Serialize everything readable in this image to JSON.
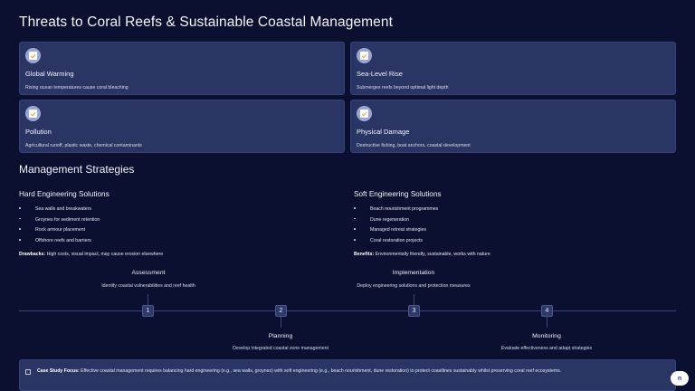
{
  "title": "Threats to Coral Reefs & Sustainable Coastal Management",
  "threats": [
    {
      "name": "Global Warming",
      "desc": "Rising ocean temperatures cause coral bleaching"
    },
    {
      "name": "Sea-Level Rise",
      "desc": "Submerges reefs beyond optimal light depth"
    },
    {
      "name": "Pollution",
      "desc": "Agricultural runoff, plastic waste, chemical contaminants"
    },
    {
      "name": "Physical Damage",
      "desc": "Destructive fishing, boat anchors, coastal development"
    }
  ],
  "strategies": {
    "title": "Management Strategies",
    "hard": {
      "title": "Hard Engineering Solutions",
      "items": [
        "Sea walls and breakwaters",
        "Groynes for sediment retention",
        "Rock armour placement",
        "Offshore reefs and barriers"
      ],
      "note_label": "Drawbacks:",
      "note_text": " High costs, visual impact, may cause erosion elsewhere"
    },
    "soft": {
      "title": "Soft Engineering Solutions",
      "items": [
        "Beach nourishment programmes",
        "Dune regeneration",
        "Managed retreat strategies",
        "Coral restoration projects"
      ],
      "note_label": "Benefits:",
      "note_text": " Environmentally friendly, sustainable, works with nature"
    }
  },
  "timeline": [
    {
      "num": "1",
      "title": "Assessment",
      "desc": "Identify coastal vulnerabilities and reef health"
    },
    {
      "num": "2",
      "title": "Planning",
      "desc": "Develop integrated coastal zone management"
    },
    {
      "num": "3",
      "title": "Implementation",
      "desc": "Deploy engineering solutions and protection measures"
    },
    {
      "num": "4",
      "title": "Monitoring",
      "desc": "Evaluate effectiveness and adapt strategies"
    }
  ],
  "case_study": {
    "label": "Case Study Focus:",
    "text": " Effective coastal management requires balancing hard engineering (e.g., sea walls, groynes) with soft engineering (e.g., beach nourishment, dune restoration) to protect coastlines sustainably whilst preserving coral reef ecosystems."
  },
  "corner_button": {
    "label": "n"
  },
  "icons": {
    "threat": "clipboard-check-icon",
    "case": "square-icon"
  }
}
